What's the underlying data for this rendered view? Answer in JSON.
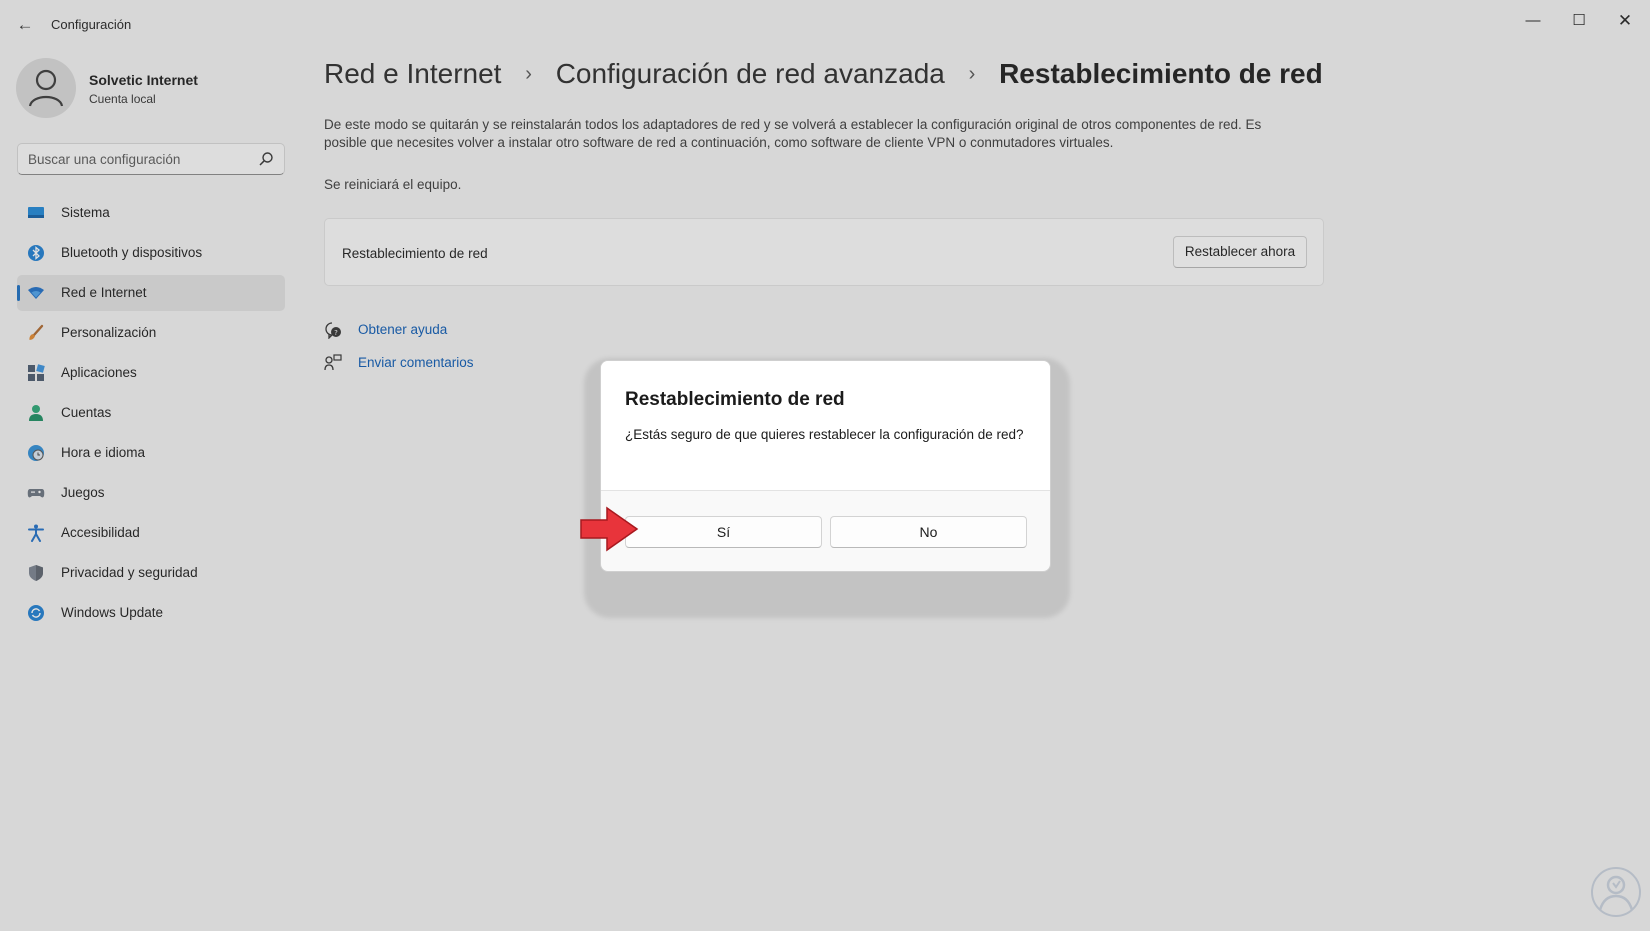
{
  "window": {
    "title": "Configuración",
    "controls": {
      "minimize": "—",
      "maximize": "☐",
      "close": "✕"
    }
  },
  "profile": {
    "name": "Solvetic Internet",
    "account_type": "Cuenta local"
  },
  "search": {
    "placeholder": "Buscar una configuración"
  },
  "sidebar": {
    "items": [
      {
        "label": "Sistema",
        "icon": "monitor-icon",
        "active": false
      },
      {
        "label": "Bluetooth y dispositivos",
        "icon": "bluetooth-icon",
        "active": false
      },
      {
        "label": "Red e Internet",
        "icon": "wifi-icon",
        "active": true
      },
      {
        "label": "Personalización",
        "icon": "brush-icon",
        "active": false
      },
      {
        "label": "Aplicaciones",
        "icon": "apps-icon",
        "active": false
      },
      {
        "label": "Cuentas",
        "icon": "person-icon",
        "active": false
      },
      {
        "label": "Hora e idioma",
        "icon": "globe-clock-icon",
        "active": false
      },
      {
        "label": "Juegos",
        "icon": "gamepad-icon",
        "active": false
      },
      {
        "label": "Accesibilidad",
        "icon": "accessibility-icon",
        "active": false
      },
      {
        "label": "Privacidad y seguridad",
        "icon": "shield-icon",
        "active": false
      },
      {
        "label": "Windows Update",
        "icon": "update-icon",
        "active": false
      }
    ]
  },
  "breadcrumb": {
    "items": [
      "Red e Internet",
      "Configuración de red avanzada"
    ],
    "current": "Restablecimiento de red",
    "separator": "›"
  },
  "main": {
    "description": "De este modo se quitarán y se reinstalarán todos los adaptadores de red y se volverá a establecer la configuración original de otros componentes de red. Es posible que necesites volver a instalar otro software de red a continuación, como software de cliente VPN o conmutadores virtuales.",
    "restart_note": "Se reiniciará el equipo.",
    "card": {
      "label": "Restablecimiento de red",
      "button": "Restablecer ahora"
    },
    "links": [
      {
        "label": "Obtener ayuda",
        "icon": "help-icon"
      },
      {
        "label": "Enviar comentarios",
        "icon": "feedback-icon"
      }
    ]
  },
  "dialog": {
    "title": "Restablecimiento de red",
    "message": "¿Estás seguro de que quieres restablecer la configuración de red?",
    "yes_label": "Sí",
    "no_label": "No"
  },
  "colors": {
    "accent": "#1a6fc4",
    "link": "#0b5bb5",
    "arrow": "#e8343b"
  }
}
